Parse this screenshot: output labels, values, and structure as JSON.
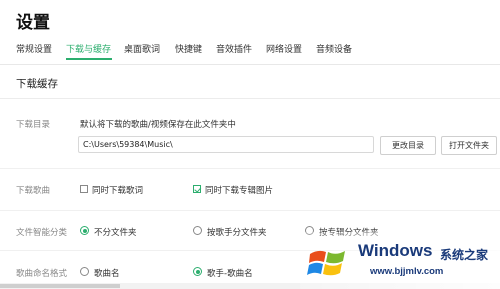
{
  "window": {
    "title": "设置"
  },
  "tabs": [
    {
      "label": "常规设置",
      "active": false
    },
    {
      "label": "下载与缓存",
      "active": true
    },
    {
      "label": "桌面歌词",
      "active": false
    },
    {
      "label": "快捷键",
      "active": false
    },
    {
      "label": "音效插件",
      "active": false
    },
    {
      "label": "网络设置",
      "active": false
    },
    {
      "label": "音频设备",
      "active": false
    }
  ],
  "section": {
    "title": "下载缓存"
  },
  "download_dir": {
    "label": "下载目录",
    "description": "默认将下载的歌曲/视频保存在此文件夹中",
    "path": "C:\\Users\\59384\\Music\\",
    "change_button": "更改目录",
    "open_button": "打开文件夹"
  },
  "download_song": {
    "label": "下载歌曲",
    "options": [
      {
        "label": "同时下载歌词",
        "checked": false
      },
      {
        "label": "同时下载专辑图片",
        "checked": true
      }
    ]
  },
  "smart_folder": {
    "label": "文件智能分类",
    "options": [
      {
        "label": "不分文件夹",
        "checked": true
      },
      {
        "label": "按歌手分文件夹",
        "checked": false
      },
      {
        "label": "按专辑分文件夹",
        "checked": false
      }
    ]
  },
  "naming": {
    "label": "歌曲命名格式",
    "options": [
      {
        "label": "歌曲名",
        "checked": false
      },
      {
        "label": "歌手-歌曲名",
        "checked": true
      }
    ]
  },
  "scroll": {
    "progress": 0.24
  },
  "watermark": {
    "brand": "Windows",
    "tagline": "系统之家",
    "url": "www.bjjmlv.com"
  },
  "colors": {
    "accent": "#2cae6e"
  }
}
